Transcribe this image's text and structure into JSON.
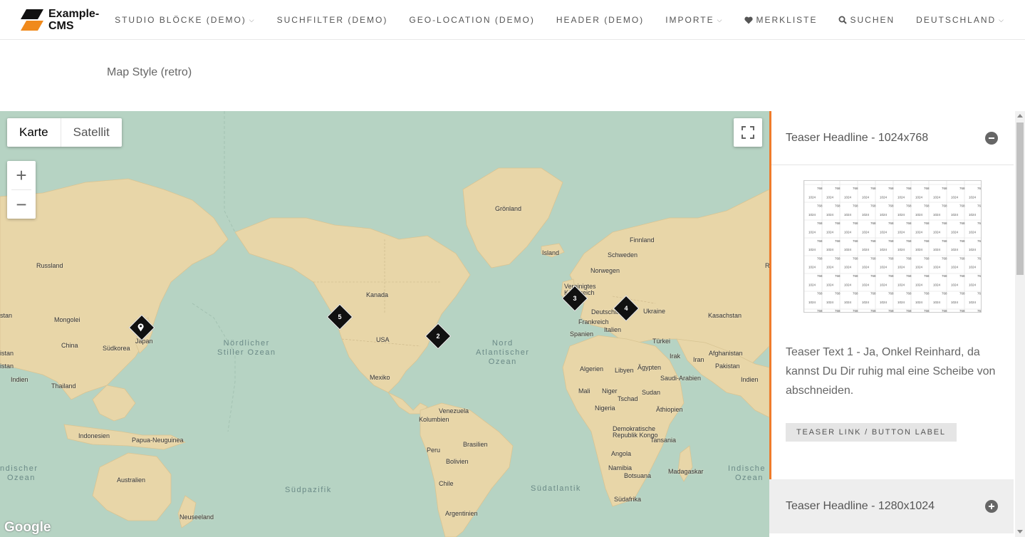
{
  "header": {
    "logo_line1": "Example-",
    "logo_line2": "CMS",
    "nav": [
      {
        "label": "STUDIO BLÖCKE (DEMO)",
        "dropdown": true
      },
      {
        "label": "SUCHFILTER (DEMO)",
        "dropdown": false
      },
      {
        "label": "GEO-LOCATION (DEMO)",
        "dropdown": false
      },
      {
        "label": "HEADER (DEMO)",
        "dropdown": false
      },
      {
        "label": "IMPORTE",
        "dropdown": true
      },
      {
        "label": "MERKLISTE",
        "icon": "heart-icon"
      },
      {
        "label": "SUCHEN",
        "icon": "search-icon"
      },
      {
        "label": "DEUTSCHLAND",
        "dropdown": true
      }
    ]
  },
  "section": {
    "heading": "Map Style (retro)"
  },
  "map": {
    "style_colors": {
      "water": "#b6d3c3",
      "land": "#e8d6a8",
      "marker": "#111111",
      "accent": "#ef7b2b"
    },
    "type_buttons": {
      "map": "Karte",
      "satellite": "Satellit"
    },
    "zoom_in": "+",
    "zoom_out": "−",
    "attribution": "Google",
    "country_labels": {
      "russland": "Russland",
      "mongolei": "Mongolei",
      "china": "China",
      "suedkorea": "Südkorea",
      "japan": "Japan",
      "thailand": "Thailand",
      "indien_left": "Indien",
      "indonesien": "Indonesien",
      "papua": "Papua-Neuguinea",
      "australien": "Australien",
      "neuseeland": "Neuseeland",
      "groenland": "Grönland",
      "kanada": "Kanada",
      "usa": "USA",
      "mexiko": "Mexiko",
      "venezuela": "Venezuela",
      "kolumbien": "Kolumbien",
      "peru": "Peru",
      "brasilien": "Brasilien",
      "bolivien": "Bolivien",
      "chile": "Chile",
      "argentinien": "Argentinien",
      "island": "Island",
      "finnland": "Finnland",
      "schweden": "Schweden",
      "norwegen": "Norwegen",
      "uk_line1": "Vereinigtes",
      "uk_line2": "Königreich",
      "deutschland": "Deutschland",
      "ukraine": "Ukraine",
      "frankreich": "Frankreich",
      "italien": "Italien",
      "spanien": "Spanien",
      "kasachstan": "Kasachstan",
      "tuerkei": "Türkei",
      "irak": "Irak",
      "iran": "Iran",
      "afghanistan": "Afghanistan",
      "pakistan": "Pakistan",
      "indien": "Indien",
      "algerien": "Algerien",
      "libyen": "Libyen",
      "aegypten": "Ägypten",
      "saudi": "Saudi-Arabien",
      "mali": "Mali",
      "niger": "Niger",
      "tschad": "Tschad",
      "sudan": "Sudan",
      "nigeria": "Nigeria",
      "aethiopien": "Äthiopien",
      "kongo_line1": "Demokratische",
      "kongo_line2": "Republik Kongo",
      "tansania": "Tansania",
      "angola": "Angola",
      "namibia": "Namibia",
      "botsuana": "Botsuana",
      "madagaskar": "Madagaskar",
      "suedafrika": "Südafrika",
      "stan_left": "stan",
      "istan_left": "istan",
      "istan_left2": "istan",
      "r_right": "R"
    },
    "ocean_labels": {
      "north_pacific_1": "Nördlicher",
      "north_pacific_2": "Stiller Ozean",
      "north_atlantic_1": "Nord",
      "north_atlantic_2": "Atlantischer",
      "north_atlantic_3": "Ozean",
      "south_pacific": "Südpazifik",
      "south_atlantic": "Südatlantik",
      "indian_left_1": "ndischer",
      "indian_left_2": "Ozean",
      "indian_right_1": "Indische",
      "indian_right_2": "Ozean"
    },
    "markers": [
      {
        "label": "",
        "icon": "location-pin-icon"
      },
      {
        "label": "5"
      },
      {
        "label": "2"
      },
      {
        "label": "3"
      },
      {
        "label": "4"
      }
    ]
  },
  "panel": {
    "item1": {
      "headline": "Teaser Headline - 1024x768",
      "icon": "minus-circle-icon",
      "image_grid": {
        "a": "768",
        "b": "1024"
      },
      "text": "Teaser Text 1 - Ja, Onkel Reinhard, da kannst Du Dir ruhig mal eine Scheibe von abschneiden.",
      "button": "TEASER LINK / BUTTON LABEL"
    },
    "item2": {
      "headline": "Teaser Headline - 1280x1024",
      "icon": "plus-circle-icon"
    }
  }
}
